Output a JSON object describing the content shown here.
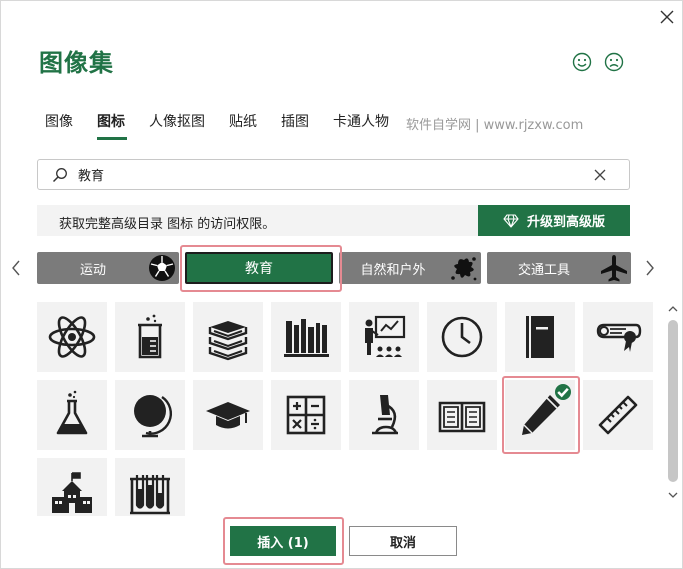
{
  "dialog": {
    "title": "图像集",
    "close_icon": "close-icon",
    "feedback": {
      "smile_icon": "smile-icon",
      "frown_icon": "frown-icon"
    }
  },
  "tabs": [
    {
      "label": "图像",
      "active": false
    },
    {
      "label": "图标",
      "active": true
    },
    {
      "label": "人像抠图",
      "active": false
    },
    {
      "label": "贴纸",
      "active": false
    },
    {
      "label": "插图",
      "active": false
    },
    {
      "label": "卡通人物",
      "active": false
    }
  ],
  "watermark": "软件自学网 | www.rjzxw.com",
  "search": {
    "value": "教育",
    "search_icon": "search-icon",
    "clear_icon": "close-icon"
  },
  "notice": {
    "text": "获取完整高级目录 图标 的访问权限。",
    "upgrade_label": "升级到高级版",
    "upgrade_icon": "diamond-icon"
  },
  "categories": [
    {
      "label": "运动",
      "icon": "soccer-ball-icon",
      "active": false
    },
    {
      "label": "教育",
      "icon": "",
      "active": true
    },
    {
      "label": "自然和户外",
      "icon": "splatter-icon",
      "active": false
    },
    {
      "label": "交通工具",
      "icon": "airplane-icon",
      "active": false
    }
  ],
  "icons": [
    {
      "name": "atom-icon",
      "selected": false
    },
    {
      "name": "beaker-icon",
      "selected": false
    },
    {
      "name": "book-stack-icon",
      "selected": false
    },
    {
      "name": "bookshelf-icon",
      "selected": false
    },
    {
      "name": "teacher-classroom-icon",
      "selected": false
    },
    {
      "name": "clock-icon",
      "selected": false
    },
    {
      "name": "notebook-icon",
      "selected": false
    },
    {
      "name": "diploma-icon",
      "selected": false
    },
    {
      "name": "flask-icon",
      "selected": false
    },
    {
      "name": "globe-icon",
      "selected": false
    },
    {
      "name": "graduation-cap-icon",
      "selected": false
    },
    {
      "name": "calculator-icon",
      "selected": false
    },
    {
      "name": "microscope-icon",
      "selected": false
    },
    {
      "name": "open-book-icon",
      "selected": false
    },
    {
      "name": "pen-icon",
      "selected": true
    },
    {
      "name": "ruler-icon",
      "selected": false
    },
    {
      "name": "school-building-icon",
      "selected": false
    },
    {
      "name": "test-tubes-icon",
      "selected": false
    }
  ],
  "footer": {
    "insert_label": "插入 (1)",
    "cancel_label": "取消"
  },
  "colors": {
    "accent": "#217346",
    "category_bg": "#7b7b7b",
    "highlight": "#e58a92",
    "tile_bg": "#f2f2f2"
  }
}
